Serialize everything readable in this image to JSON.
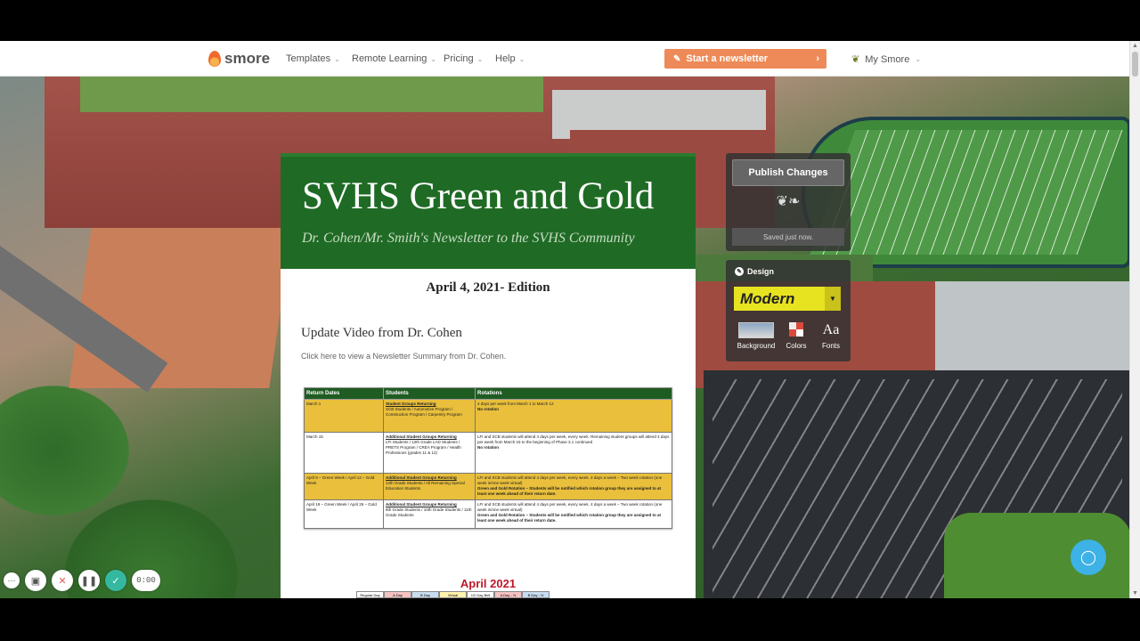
{
  "nav": {
    "logo": "smore",
    "items": [
      {
        "label": "Templates"
      },
      {
        "label": "Remote Learning"
      },
      {
        "label": "Pricing"
      },
      {
        "label": "Help"
      }
    ],
    "start_button": "Start a newsletter",
    "account": "My Smore"
  },
  "newsletter": {
    "title": "SVHS Green and Gold",
    "subtitle": "Dr. Cohen/Mr. Smith's Newsletter to the SVHS Community",
    "edition": "April 4, 2021- Edition",
    "video_heading": "Update Video from Dr. Cohen",
    "video_link": "Click here to view a Newsletter Summary from Dr. Cohen.",
    "table": {
      "headers": [
        "Return Dates",
        "Students",
        "Rotations"
      ],
      "rows": [
        {
          "date": "March 1",
          "group": "Student Groups Returning",
          "students": "SCB Students / Automotive Program / Construction Program / Carpentry Program",
          "rotation": "4 days per week from March 1 to March 12",
          "rotation2": "No rotation"
        },
        {
          "date": "March 15",
          "group": "Additional Student Groups Returning",
          "students": "LFI Students / 12th Grade LAD Students / PRETS Program / CREA Program / Health Professions (grades 11 & 12)",
          "rotation": "LFI and SCB students will attend 4 days per week, every week. Remaining student groups will attend 4 days per week from March 15 to the beginning of Phase 3.1 continued",
          "rotation2": "No rotation"
        },
        {
          "date": "April 8 – Green Week / April 12 – Gold Week",
          "group": "Additional Student Groups Returning",
          "students": "12th Grade Students / All Remaining Special Education Students",
          "rotation": "LFI and SCB students will attend 4 days per week, every week. 4 days a week – Two week rotation (one week in/one week virtual)",
          "rotation2": "Green and Gold Rotation – Students will be notified which rotation group they are assigned to at least one week ahead of their return date."
        },
        {
          "date": "April 19 – Green Week / April 26 – Gold Week",
          "group": "Additional Student Groups Returning",
          "students": "9th Grade Students / 10th Grade Students / 11th Grade Students",
          "rotation": "LFI and SCB students will attend 4 days per week, every week. 4 days a week – Two week rotation (one week in/one week virtual)",
          "rotation2": "Green and Gold Rotation – Students will be notified which rotation group they are assigned to at least one week ahead of their return date."
        }
      ]
    },
    "calendar_title": "April 2021",
    "calendar_legend": [
      {
        "label": "Regular Day",
        "color": "#ffffff"
      },
      {
        "label": "A Day",
        "color": "#f4c2c2"
      },
      {
        "label": "B Day",
        "color": "#c8dcf0"
      },
      {
        "label": "Virtual Check-In Day",
        "color": "#fff3b0"
      },
      {
        "label": "1/2 Day Bell",
        "color": "#ffffff"
      },
      {
        "label": "A Day - ½ Day",
        "color": "#f4c2c2"
      },
      {
        "label": "B Day - ½ Day",
        "color": "#c8dcf0"
      }
    ]
  },
  "editor": {
    "publish": "Publish Changes",
    "status": "Saved just now.",
    "design_label": "Design",
    "theme": "Modern",
    "options": [
      {
        "label": "Background"
      },
      {
        "label": "Colors"
      },
      {
        "label": "Fonts"
      }
    ]
  },
  "recorder": {
    "timer": "0:00"
  },
  "colors": {
    "header_green": "#1f6b25",
    "accent_orange": "#ee8a57",
    "theme_yellow": "#e8e320",
    "chat_blue": "#3db2e6"
  }
}
